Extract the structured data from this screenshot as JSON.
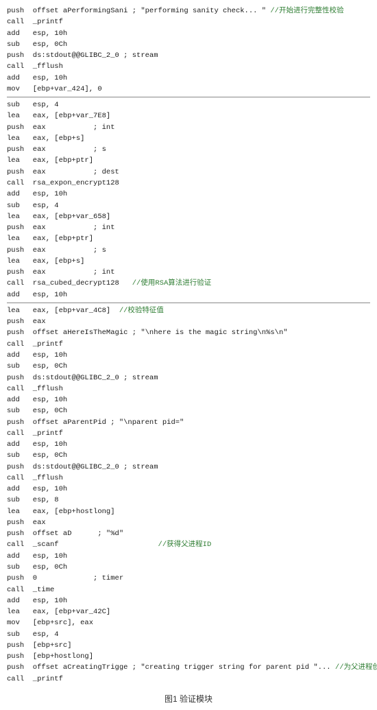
{
  "caption": "图1 验证模块",
  "sections": [
    {
      "id": "section1",
      "lines": [
        {
          "text": "push  offset aPerformingSani ; \"performing sanity check... \" ",
          "comment": "//开始进行完整性校验"
        },
        {
          "text": "call  _printf",
          "comment": ""
        },
        {
          "text": "add   esp, 10h",
          "comment": ""
        },
        {
          "text": "sub   esp, 0Ch",
          "comment": ""
        },
        {
          "text": "push  ds:stdout@@GLIBC_2_0 ; stream",
          "comment": ""
        },
        {
          "text": "call  _fflush",
          "comment": ""
        },
        {
          "text": "add   esp, 10h",
          "comment": ""
        },
        {
          "text": "mov   [ebp+var_424], 0",
          "comment": ""
        }
      ]
    },
    {
      "id": "sep1",
      "separator": true
    },
    {
      "id": "section2",
      "lines": [
        {
          "text": "sub   esp, 4",
          "comment": ""
        },
        {
          "text": "lea   eax, [ebp+var_7E8]",
          "comment": ""
        },
        {
          "text": "push  eax           ; int",
          "comment": ""
        },
        {
          "text": "lea   eax, [ebp+s]",
          "comment": ""
        },
        {
          "text": "push  eax           ; s",
          "comment": ""
        },
        {
          "text": "lea   eax, [ebp+ptr]",
          "comment": ""
        },
        {
          "text": "push  eax           ; dest",
          "comment": ""
        },
        {
          "text": "call  rsa_expon_encrypt128",
          "comment": ""
        },
        {
          "text": "add   esp, 10h",
          "comment": ""
        },
        {
          "text": "sub   esp, 4",
          "comment": ""
        },
        {
          "text": "lea   eax, [ebp+var_658]",
          "comment": ""
        },
        {
          "text": "push  eax           ; int",
          "comment": ""
        },
        {
          "text": "lea   eax, [ebp+ptr]",
          "comment": ""
        },
        {
          "text": "push  eax           ; s",
          "comment": ""
        },
        {
          "text": "lea   eax, [ebp+s]",
          "comment": ""
        },
        {
          "text": "push  eax           ; int",
          "comment": ""
        },
        {
          "text": "call  rsa_cubed_decrypt128   ",
          "comment": "//使用RSA算法进行验证"
        },
        {
          "text": "add   esp, 10h",
          "comment": ""
        }
      ]
    },
    {
      "id": "sep2",
      "separator": true
    },
    {
      "id": "section3",
      "lines": [
        {
          "text": "lea   eax, [ebp+var_4C8]  ",
          "comment": "//校验特征值"
        },
        {
          "text": "push  eax",
          "comment": ""
        },
        {
          "text": "push  offset aHereIsTheMagic ; \"\\nhere is the magic string\\n%s\\n\"",
          "comment": ""
        },
        {
          "text": "call  _printf",
          "comment": ""
        },
        {
          "text": "add   esp, 10h",
          "comment": ""
        },
        {
          "text": "sub   esp, 0Ch",
          "comment": ""
        },
        {
          "text": "push  ds:stdout@@GLIBC_2_0 ; stream",
          "comment": ""
        },
        {
          "text": "call  _fflush",
          "comment": ""
        },
        {
          "text": "add   esp, 10h",
          "comment": ""
        },
        {
          "text": "sub   esp, 0Ch",
          "comment": ""
        },
        {
          "text": "push  offset aParentPid ; \"\\nparent pid=\"",
          "comment": ""
        },
        {
          "text": "call  _printf",
          "comment": ""
        },
        {
          "text": "add   esp, 10h",
          "comment": ""
        },
        {
          "text": "sub   esp, 0Ch",
          "comment": ""
        },
        {
          "text": "push  ds:stdout@@GLIBC_2_0 ; stream",
          "comment": ""
        },
        {
          "text": "call  _fflush",
          "comment": ""
        },
        {
          "text": "add   esp, 10h",
          "comment": ""
        },
        {
          "text": "sub   esp, 8",
          "comment": ""
        },
        {
          "text": "lea   eax, [ebp+hostlong]",
          "comment": ""
        },
        {
          "text": "push  eax",
          "comment": ""
        },
        {
          "text": "push  offset aD      ; \"%d\"",
          "comment": ""
        },
        {
          "text": "call  _scanf                       ",
          "comment": "//获得父进程ID"
        },
        {
          "text": "add   esp, 10h",
          "comment": ""
        },
        {
          "text": "sub   esp, 0Ch",
          "comment": ""
        },
        {
          "text": "push  0             ; timer",
          "comment": ""
        },
        {
          "text": "call  _time",
          "comment": ""
        },
        {
          "text": "add   esp, 10h",
          "comment": ""
        },
        {
          "text": "lea   eax, [ebp+var_42C]",
          "comment": ""
        },
        {
          "text": "mov   [ebp+src], eax",
          "comment": ""
        },
        {
          "text": "sub   esp, 4",
          "comment": ""
        },
        {
          "text": "push  [ebp+src]",
          "comment": ""
        },
        {
          "text": "push  [ebp+hostlong]",
          "comment": ""
        },
        {
          "text": "push  offset aCreatingTrigge ; \"creating trigger string for parent pid \"... ",
          "comment": "//为父进程创建触发器"
        },
        {
          "text": "call  _printf",
          "comment": ""
        }
      ]
    }
  ]
}
